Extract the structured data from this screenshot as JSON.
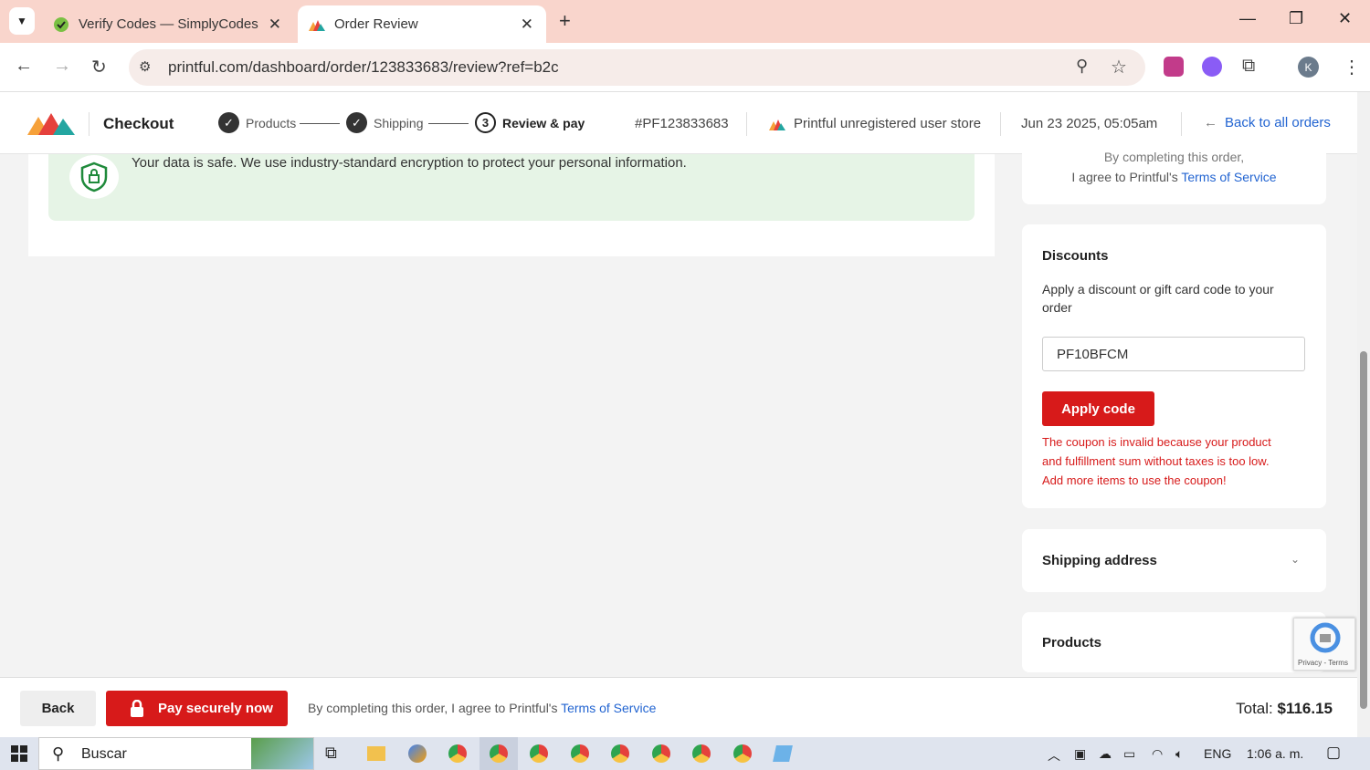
{
  "browser": {
    "tabs": [
      {
        "title": "Verify Codes — SimplyCodes"
      },
      {
        "title": "Order Review"
      }
    ],
    "url": "printful.com/dashboard/order/123833683/review?ref=b2c",
    "profile_initial": "K"
  },
  "header": {
    "title": "Checkout",
    "steps": [
      {
        "label": "Products",
        "state": "done"
      },
      {
        "label": "Shipping",
        "state": "done"
      },
      {
        "num": "3",
        "label": "Review & pay",
        "state": "current"
      }
    ],
    "order_id": "#PF123833683",
    "store_name": "Printful unregistered user store",
    "date": "Jun 23 2025, 05:05am",
    "back_link": "Back to all orders"
  },
  "security": {
    "text": "Your data is safe. We use industry-standard encryption to protect your personal information."
  },
  "tos_top": {
    "line1": "By completing this order,",
    "line2": "I agree to Printful's ",
    "link": "Terms of Service"
  },
  "discounts": {
    "title": "Discounts",
    "description": "Apply a discount or gift card code to your order",
    "code_value": "PF10BFCM",
    "apply_label": "Apply code",
    "error": "The coupon is invalid because your product and fulfillment sum without taxes is too low. Add more items to use the coupon!"
  },
  "shipping_address": {
    "title": "Shipping address"
  },
  "products_section": {
    "title": "Products"
  },
  "recaptcha": {
    "text": "Privacy - Terms"
  },
  "footer": {
    "back_label": "Back",
    "pay_label": "Pay securely now",
    "tos_text": "By completing this order, I agree to Printful's ",
    "tos_link": "Terms of Service",
    "total_label": "Total: ",
    "total_value": "$116.15"
  },
  "taskbar": {
    "search_placeholder": "Buscar",
    "lang": "ENG",
    "time": "1:06 a. m."
  },
  "colors": {
    "accent_red": "#d71a1a",
    "link_blue": "#2264d1",
    "safe_green": "#e6f4e6",
    "tab_bar": "#f9d5cc"
  }
}
